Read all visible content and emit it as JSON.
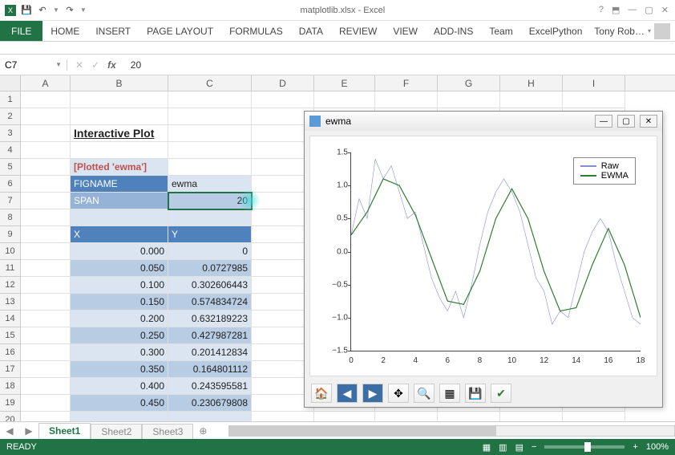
{
  "window": {
    "title": "matplotlib.xlsx - Excel",
    "help_icon": "?",
    "user_name": "Tony Rob…"
  },
  "qat": {
    "save": "💾",
    "undo": "↶",
    "redo": "↷"
  },
  "ribbon": {
    "file": "FILE",
    "tabs": [
      "HOME",
      "INSERT",
      "PAGE LAYOUT",
      "FORMULAS",
      "DATA",
      "REVIEW",
      "VIEW",
      "ADD-INS",
      "Team",
      "ExcelPython"
    ]
  },
  "formula_bar": {
    "name_box": "C7",
    "fx": "fx",
    "value": "20"
  },
  "columns": [
    "A",
    "B",
    "C",
    "D",
    "E",
    "F",
    "G",
    "H",
    "I"
  ],
  "rows": [
    "1",
    "2",
    "3",
    "4",
    "5",
    "6",
    "7",
    "8",
    "9",
    "10",
    "11",
    "12",
    "13",
    "14",
    "15",
    "16",
    "17",
    "18",
    "19",
    "20"
  ],
  "sheet": {
    "title": "Interactive Plot",
    "plotted": "[Plotted 'ewma']",
    "figname_label": "FIGNAME",
    "figname_value": "ewma",
    "span_label": "SPAN",
    "span_value": "20",
    "xh": "X",
    "yh": "Y",
    "data": [
      {
        "x": "0.000",
        "y": "0"
      },
      {
        "x": "0.050",
        "y": "0.0727985"
      },
      {
        "x": "0.100",
        "y": "0.302606443"
      },
      {
        "x": "0.150",
        "y": "0.574834724"
      },
      {
        "x": "0.200",
        "y": "0.632189223"
      },
      {
        "x": "0.250",
        "y": "0.427987281"
      },
      {
        "x": "0.300",
        "y": "0.201412834"
      },
      {
        "x": "0.350",
        "y": "0.164801112"
      },
      {
        "x": "0.400",
        "y": "0.243595581"
      },
      {
        "x": "0.450",
        "y": "0.230679808"
      }
    ]
  },
  "sheet_tabs": {
    "active": "Sheet1",
    "others": [
      "Sheet2",
      "Sheet3"
    ],
    "add": "⊕"
  },
  "status": {
    "ready": "READY",
    "zoom": "100%"
  },
  "plot_window": {
    "title": "ewma",
    "legend": [
      "Raw",
      "EWMA"
    ],
    "yticks": [
      "1.5",
      "1.0",
      "0.5",
      "0.0",
      "−0.5",
      "−1.0",
      "−1.5"
    ],
    "xticks": [
      "0",
      "2",
      "4",
      "6",
      "8",
      "10",
      "12",
      "14",
      "16",
      "18"
    ],
    "toolbar": [
      "home",
      "back",
      "forward",
      "pan",
      "zoom",
      "subplots",
      "save",
      "ok"
    ]
  },
  "chart_data": {
    "type": "line",
    "title": "",
    "xlabel": "",
    "ylabel": "",
    "xlim": [
      0,
      18
    ],
    "ylim": [
      -1.5,
      1.5
    ],
    "series": [
      {
        "name": "Raw",
        "color": "#8a8ad6",
        "x": [
          0,
          0.5,
          1,
          1.5,
          2,
          2.5,
          3,
          3.5,
          4,
          4.5,
          5,
          5.5,
          6,
          6.5,
          7,
          7.5,
          8,
          8.5,
          9,
          9.5,
          10,
          10.5,
          11,
          11.5,
          12,
          12.5,
          13,
          13.5,
          14,
          14.5,
          15,
          15.5,
          16,
          16.5,
          17,
          17.5,
          18
        ],
        "y": [
          0.25,
          0.8,
          0.5,
          1.4,
          1.1,
          1.3,
          0.9,
          0.5,
          0.6,
          0.1,
          -0.4,
          -0.7,
          -0.9,
          -0.6,
          -1.0,
          -0.5,
          0.1,
          0.6,
          0.9,
          1.1,
          0.9,
          0.6,
          0.1,
          -0.4,
          -0.6,
          -1.1,
          -0.9,
          -1.0,
          -0.5,
          0.0,
          0.3,
          0.5,
          0.3,
          -0.2,
          -0.6,
          -1.0,
          -1.1
        ]
      },
      {
        "name": "EWMA",
        "color": "#2e7d32",
        "x": [
          0,
          1,
          2,
          3,
          4,
          5,
          6,
          7,
          8,
          9,
          10,
          11,
          12,
          13,
          14,
          15,
          16,
          17,
          18
        ],
        "y": [
          0.25,
          0.6,
          1.1,
          1.0,
          0.55,
          -0.1,
          -0.75,
          -0.8,
          -0.3,
          0.5,
          0.95,
          0.5,
          -0.3,
          -0.9,
          -0.85,
          -0.2,
          0.35,
          -0.2,
          -1.0
        ]
      }
    ],
    "legend_position": "upper right"
  }
}
